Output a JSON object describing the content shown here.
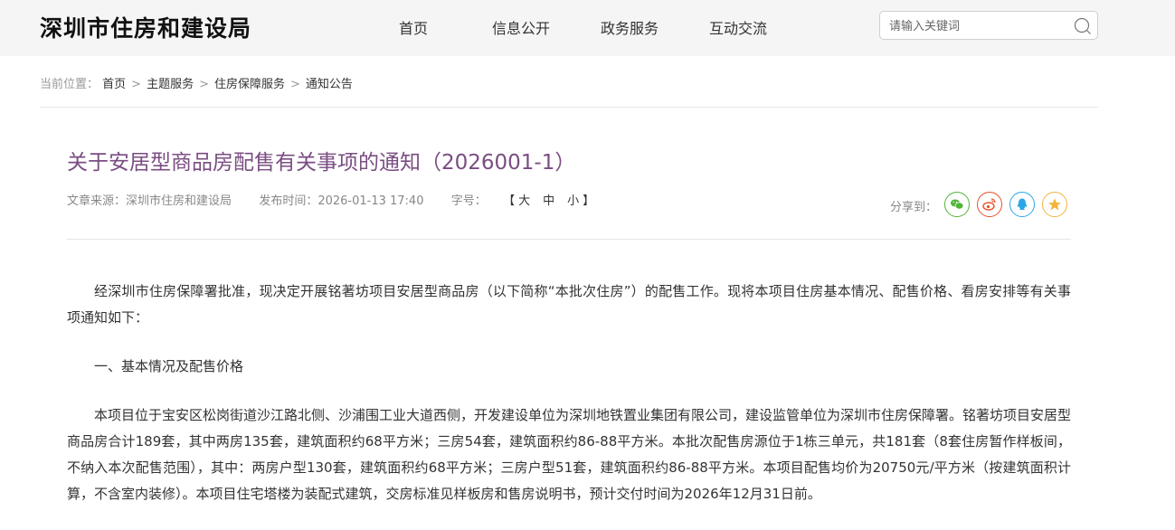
{
  "header": {
    "site_title": "深圳市住房和建设局",
    "nav": [
      {
        "label": "首页"
      },
      {
        "label": "信息公开"
      },
      {
        "label": "政务服务"
      },
      {
        "label": "互动交流"
      }
    ],
    "search": {
      "placeholder": "请输入关键词",
      "value": "",
      "icon": "search-icon"
    }
  },
  "breadcrumb": {
    "label": "当前位置：",
    "items": [
      "首页",
      "主题服务",
      "住房保障服务",
      "通知公告"
    ],
    "separator": ">"
  },
  "article": {
    "title": "关于安居型商品房配售有关事项的通知（2026001-1）",
    "source_label": "文章来源：",
    "source": "深圳市住房和建设局",
    "publish_label": "发布时间：",
    "publish_time": "2026-01-13 17:40",
    "font_label": "字号：",
    "font_open": "【",
    "font_sizes": [
      "大",
      "中",
      "小"
    ],
    "font_close": "】",
    "share_label": "分享到：",
    "share": [
      {
        "name": "wechat-icon",
        "color": "#51b337"
      },
      {
        "name": "weibo-icon",
        "color": "#e6512a"
      },
      {
        "name": "qq-icon",
        "color": "#2aa7e6"
      },
      {
        "name": "qzone-star-icon",
        "color": "#f3b43c"
      }
    ],
    "paragraphs": [
      "经深圳市住房保障署批准，现决定开展铭著坊项目安居型商品房（以下简称“本批次住房”）的配售工作。现将本项目住房基本情况、配售价格、看房安排等有关事项通知如下：",
      "一、基本情况及配售价格",
      "本项目位于宝安区松岗街道沙江路北侧、沙浦围工业大道西侧，开发建设单位为深圳地铁置业集团有限公司，建设监管单位为深圳市住房保障署。铭著坊项目安居型商品房合计189套，其中两房135套，建筑面积约68平方米；三房54套，建筑面积约86-88平方米。本批次配售房源位于1栋三单元，共181套（8套住房暂作样板间，不纳入本次配售范围），其中：两房户型130套，建筑面积约68平方米；三房户型51套，建筑面积约86-88平方米。本项目配售均价为20750元/平方米（按建筑面积计算，不含室内装修）。本项目住宅塔楼为装配式建筑，交房标准见样板房和售房说明书，预计交付时间为2026年12月31日前。"
    ]
  }
}
